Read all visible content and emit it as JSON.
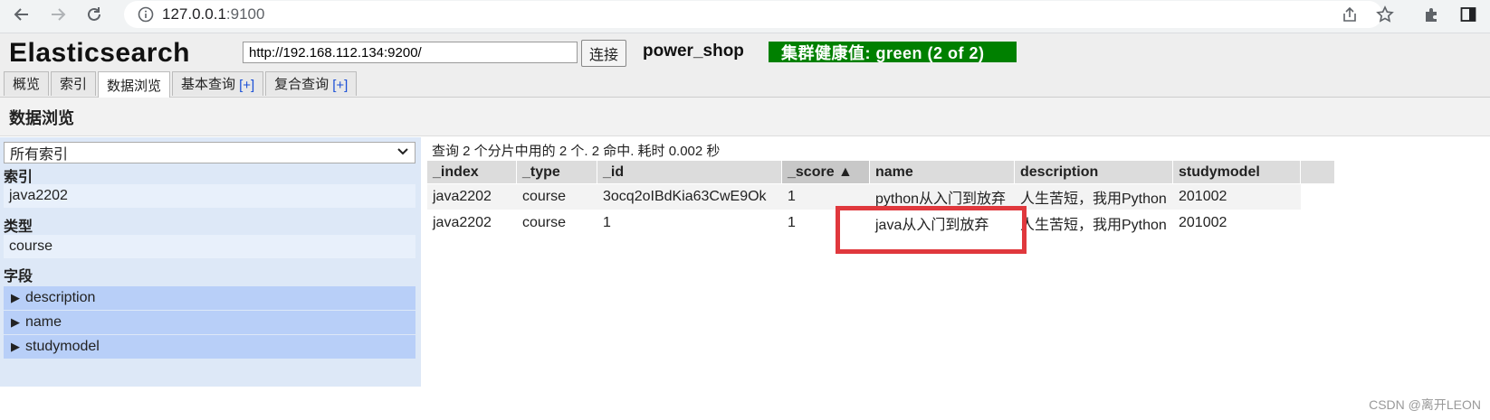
{
  "browser": {
    "url_host": "127.0.0.1",
    "url_port": ":9100",
    "icons": [
      "back-icon",
      "forward-icon",
      "reload-icon",
      "info-icon",
      "share-icon",
      "star-icon",
      "extensions-icon",
      "sidepanel-icon"
    ]
  },
  "header": {
    "logo": "Elasticsearch",
    "connection_url": "http://192.168.112.134:9200/",
    "connect_label": "连接",
    "cluster_name": "power_shop",
    "health": "集群健康值: green (2 of 2)",
    "health_color": "#008000",
    "tabs": [
      {
        "label": "概览",
        "plus": ""
      },
      {
        "label": "索引",
        "plus": ""
      },
      {
        "label": "数据浏览",
        "plus": ""
      },
      {
        "label": "基本查询",
        "plus": "[+]"
      },
      {
        "label": "复合查询",
        "plus": "[+]"
      }
    ],
    "active_tab": "数据浏览"
  },
  "section": {
    "title": "数据浏览"
  },
  "sidebar": {
    "index_select": "所有索引",
    "index_heading": "索引",
    "index_item": "java2202",
    "type_heading": "类型",
    "type_item": "course",
    "field_heading": "字段",
    "fields": [
      "description",
      "name",
      "studymodel"
    ]
  },
  "results": {
    "summary": "查询 2 个分片中用的 2 个. 2 命中. 耗时 0.002 秒",
    "columns": [
      "_index",
      "_type",
      "_id",
      "_score ▲",
      "name",
      "description",
      "studymodel",
      ""
    ],
    "rows": [
      [
        "java2202",
        "course",
        "3ocq2oIBdKia63CwE9Ok",
        "1",
        "python从入门到放弃",
        "人生苦短，我用Python",
        "201002"
      ],
      [
        "java2202",
        "course",
        "1",
        "1",
        "java从入门到放弃",
        "人生苦短，我用Python",
        "201002"
      ]
    ]
  },
  "annotation_color": "#e0383d",
  "watermark": "CSDN @离开LEON"
}
